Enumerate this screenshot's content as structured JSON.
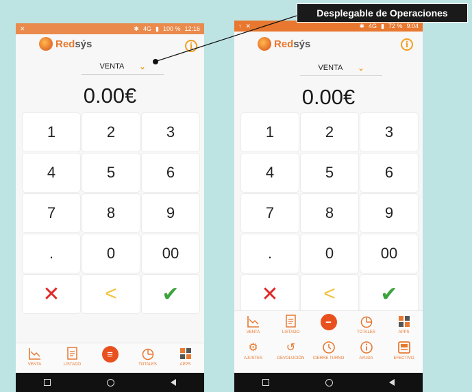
{
  "brand": {
    "name_a": "Red",
    "name_b": "sýs"
  },
  "callout": {
    "text": "Desplegable de Operaciones"
  },
  "left_phone": {
    "status": {
      "time": "12:16",
      "battery": "100 %",
      "network": "4G"
    },
    "operation": "VENTA",
    "amount": "0.00€",
    "keys": [
      "1",
      "2",
      "3",
      "4",
      "5",
      "6",
      "7",
      "8",
      "9",
      ".",
      "0",
      "00"
    ],
    "menu": [
      {
        "label": "VENTA",
        "icon": "chart-icon"
      },
      {
        "label": "LISTADO",
        "icon": "list-icon"
      },
      {
        "label": "",
        "icon": "menu-handle-icon"
      },
      {
        "label": "TOTALES",
        "icon": "pie-icon"
      },
      {
        "label": "APPS",
        "icon": "apps-icon"
      }
    ]
  },
  "right_phone": {
    "status": {
      "time": "9:04",
      "battery": "72 %",
      "network": "4G"
    },
    "operation": "VENTA",
    "amount": "0.00€",
    "keys": [
      "1",
      "2",
      "3",
      "4",
      "5",
      "6",
      "7",
      "8",
      "9",
      ".",
      "0",
      "00"
    ],
    "menu_row1": [
      {
        "label": "VENTA",
        "icon": "chart-icon"
      },
      {
        "label": "LISTADO",
        "icon": "list-icon"
      },
      {
        "label": "",
        "icon": "minus-handle-icon"
      },
      {
        "label": "TOTALES",
        "icon": "pie-icon"
      },
      {
        "label": "APPS",
        "icon": "apps-icon"
      }
    ],
    "menu_row2": [
      {
        "label": "AJUSTES",
        "icon": "gear-icon"
      },
      {
        "label": "DEVOLUCIÓN",
        "icon": "refund-icon"
      },
      {
        "label": "CIERRE TURNO",
        "icon": "clock-icon"
      },
      {
        "label": "AYUDA",
        "icon": "info-icon"
      },
      {
        "label": "EFECTIVO",
        "icon": "cash-register-icon"
      }
    ]
  },
  "colors": {
    "accent": "#e8782f",
    "cancel": "#e02828",
    "back": "#f2c23a",
    "ok": "#3da33d",
    "background": "#bde3e3"
  }
}
